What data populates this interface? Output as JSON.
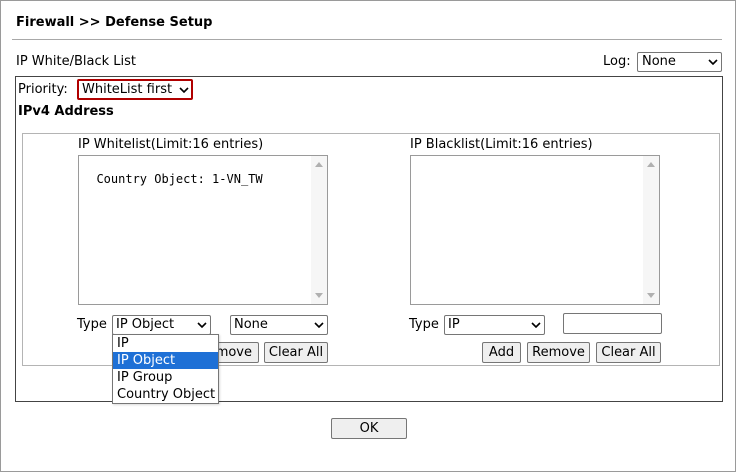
{
  "page": {
    "title": "Firewall >> Defense Setup"
  },
  "section": {
    "title": "IP White/Black List",
    "log_label": "Log:",
    "log_value": "None"
  },
  "priority": {
    "label": "Priority:",
    "value": "WhiteList first",
    "accent_color": "#b00000"
  },
  "ipv4_heading": "IPv4 Address",
  "whitelist": {
    "title": "IP Whitelist(Limit:16 entries)",
    "entries": "Country Object: 1-VN_TW",
    "type_label": "Type",
    "type_value": "IP Object",
    "object_value": "None",
    "remove_label_visible": "move",
    "clear_all_label": "Clear All",
    "type_options": [
      {
        "label": "IP",
        "selected": false
      },
      {
        "label": "IP Object",
        "selected": true
      },
      {
        "label": "IP Group",
        "selected": false
      },
      {
        "label": "Country Object",
        "selected": false
      }
    ]
  },
  "blacklist": {
    "title": "IP Blacklist(Limit:16 entries)",
    "entries": "",
    "type_label": "Type",
    "type_value": "IP",
    "ip_value": "",
    "add_label": "Add",
    "remove_label": "Remove",
    "clear_all_label": "Clear All"
  },
  "ok_label": "OK"
}
